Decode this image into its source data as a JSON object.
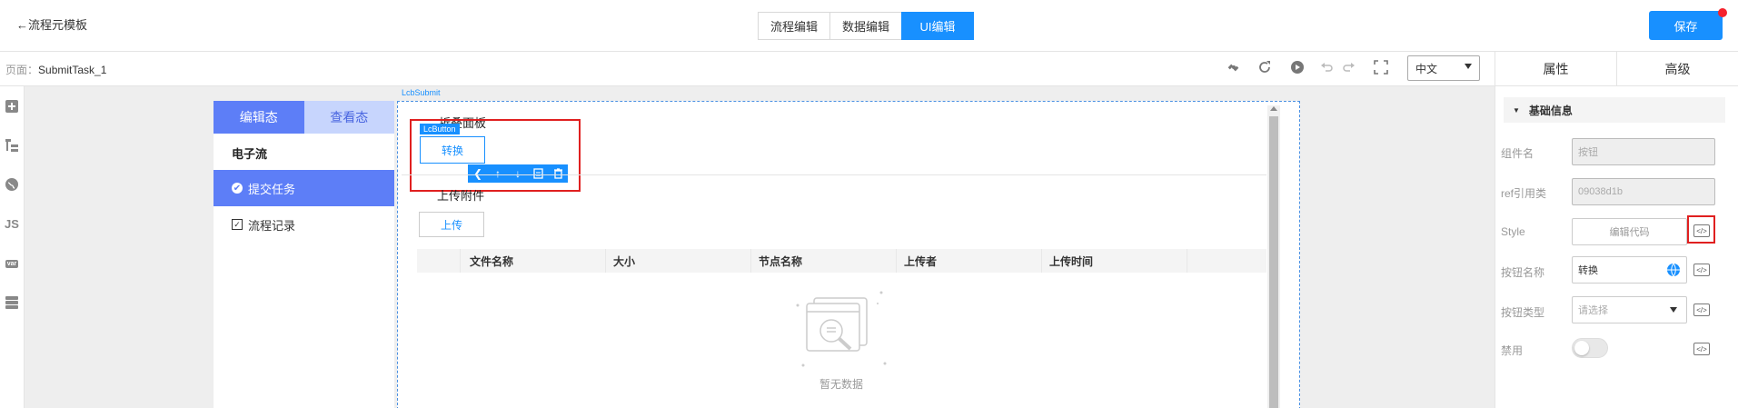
{
  "header": {
    "back_label": "←流程元模板",
    "tabs": [
      "流程编辑",
      "数据编辑",
      "UI编辑"
    ],
    "active_tab": "UI编辑",
    "save_label": "保存"
  },
  "subbar": {
    "page_prefix": "页面：",
    "page_name": "SubmitTask_1",
    "language": "中文"
  },
  "leftbar": {
    "icons": [
      "add-icon",
      "tree-icon",
      "globe-icon",
      "js-icon",
      "var-icon",
      "database-icon"
    ],
    "js_label": "JS",
    "var_label": "var"
  },
  "canvas": {
    "component_label": "LcbSubmit",
    "nav": {
      "tab_edit": "编辑态",
      "tab_view": "查看态",
      "heading": "电子流",
      "items": [
        "提交任务",
        "流程记录"
      ]
    },
    "fold_panel_title": "折叠面板",
    "lcbutton_tag": "LcButton",
    "convert_button": "转换",
    "upload_title": "上传附件",
    "upload_button": "上传",
    "table_headers": [
      "文件名称",
      "大小",
      "节点名称",
      "上传者",
      "上传时间"
    ],
    "empty_text": "暂无数据"
  },
  "right_panel": {
    "tab_props": "属性",
    "tab_advanced": "高级",
    "section_title": "基础信息",
    "fields": {
      "component_name_label": "组件名",
      "component_name_value": "按钮",
      "ref_label": "ref引用类",
      "ref_value": "09038d1b",
      "style_label": "Style",
      "style_button": "编辑代码",
      "button_name_label": "按钮名称",
      "button_name_value": "转换",
      "button_type_label": "按钮类型",
      "button_type_placeholder": "请选择",
      "disabled_label": "禁用",
      "disabled_on": false
    }
  },
  "colors": {
    "primary": "#1890ff",
    "nav_active": "#5d7ef7",
    "nav_light": "#c7d5fd",
    "highlight": "#e02020"
  }
}
